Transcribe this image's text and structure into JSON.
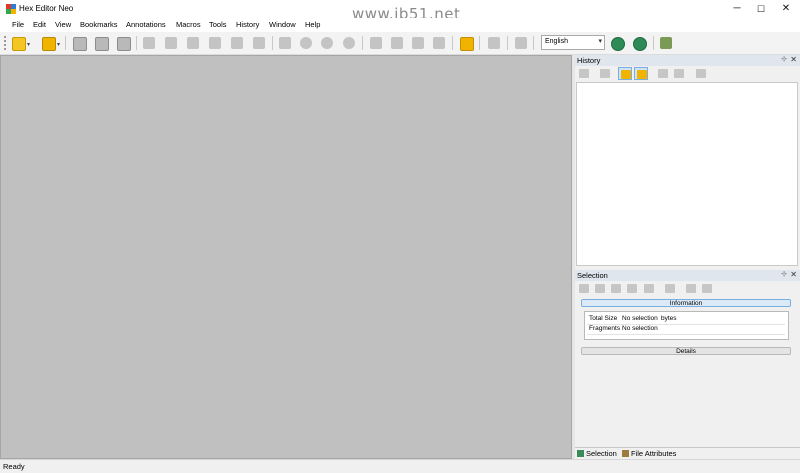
{
  "window": {
    "title": "Hex Editor Neo",
    "watermark": "www.jb51.net",
    "controls": {
      "minimize": "─",
      "maximize": "☐",
      "close": "✕"
    }
  },
  "menu": [
    "File",
    "Edit",
    "View",
    "Bookmarks",
    "Annotations",
    "Macros",
    "Tools",
    "History",
    "Window",
    "Help"
  ],
  "toolbar": {
    "icons": [
      "new-file-icon",
      "open-file-icon",
      "save-icon",
      "save-as-icon",
      "save-all-icon",
      "undo-icon",
      "redo-icon",
      "cut-icon",
      "copy-icon",
      "paste-icon",
      "fill-icon",
      "find-icon",
      "zoom-icon",
      "find-next-icon",
      "find-previous-icon",
      "replace-icon",
      "replace-next-icon",
      "properties-icon",
      "columns-icon",
      "fit-icon",
      "encoding-icon",
      "dual-view-icon",
      "globe-update-icon",
      "globe-web-icon",
      "tools-icon"
    ],
    "language": "English",
    "colors": {
      "accent": "#f0b400",
      "globe": "#2e8b57",
      "highlight": "#cde3f7"
    }
  },
  "history_panel": {
    "title": "History",
    "pin": "⊹",
    "close": "✕",
    "tool_icons": [
      "history-undo-icon",
      "history-delete-icon",
      "history-mode-a-icon",
      "history-mode-b-icon",
      "history-filter-icon",
      "history-sort-icon",
      "history-export-icon"
    ]
  },
  "selection_panel": {
    "title": "Selection",
    "pin": "⊹",
    "close": "✕",
    "tool_icons": [
      "select-all-icon",
      "select-block-icon",
      "select-copy-icon",
      "select-hex-icon",
      "select-fill-icon",
      "select-hand-icon",
      "select-export-icon",
      "select-import-icon"
    ],
    "information_label": "Information",
    "rows": [
      {
        "label": "Total Size",
        "value": "No selection",
        "unit": "bytes"
      },
      {
        "label": "Fragments",
        "value": "No selection",
        "unit": ""
      }
    ],
    "details_label": "Details"
  },
  "bottom_tabs": [
    "Selection",
    "File Attributes"
  ],
  "status": "Ready"
}
